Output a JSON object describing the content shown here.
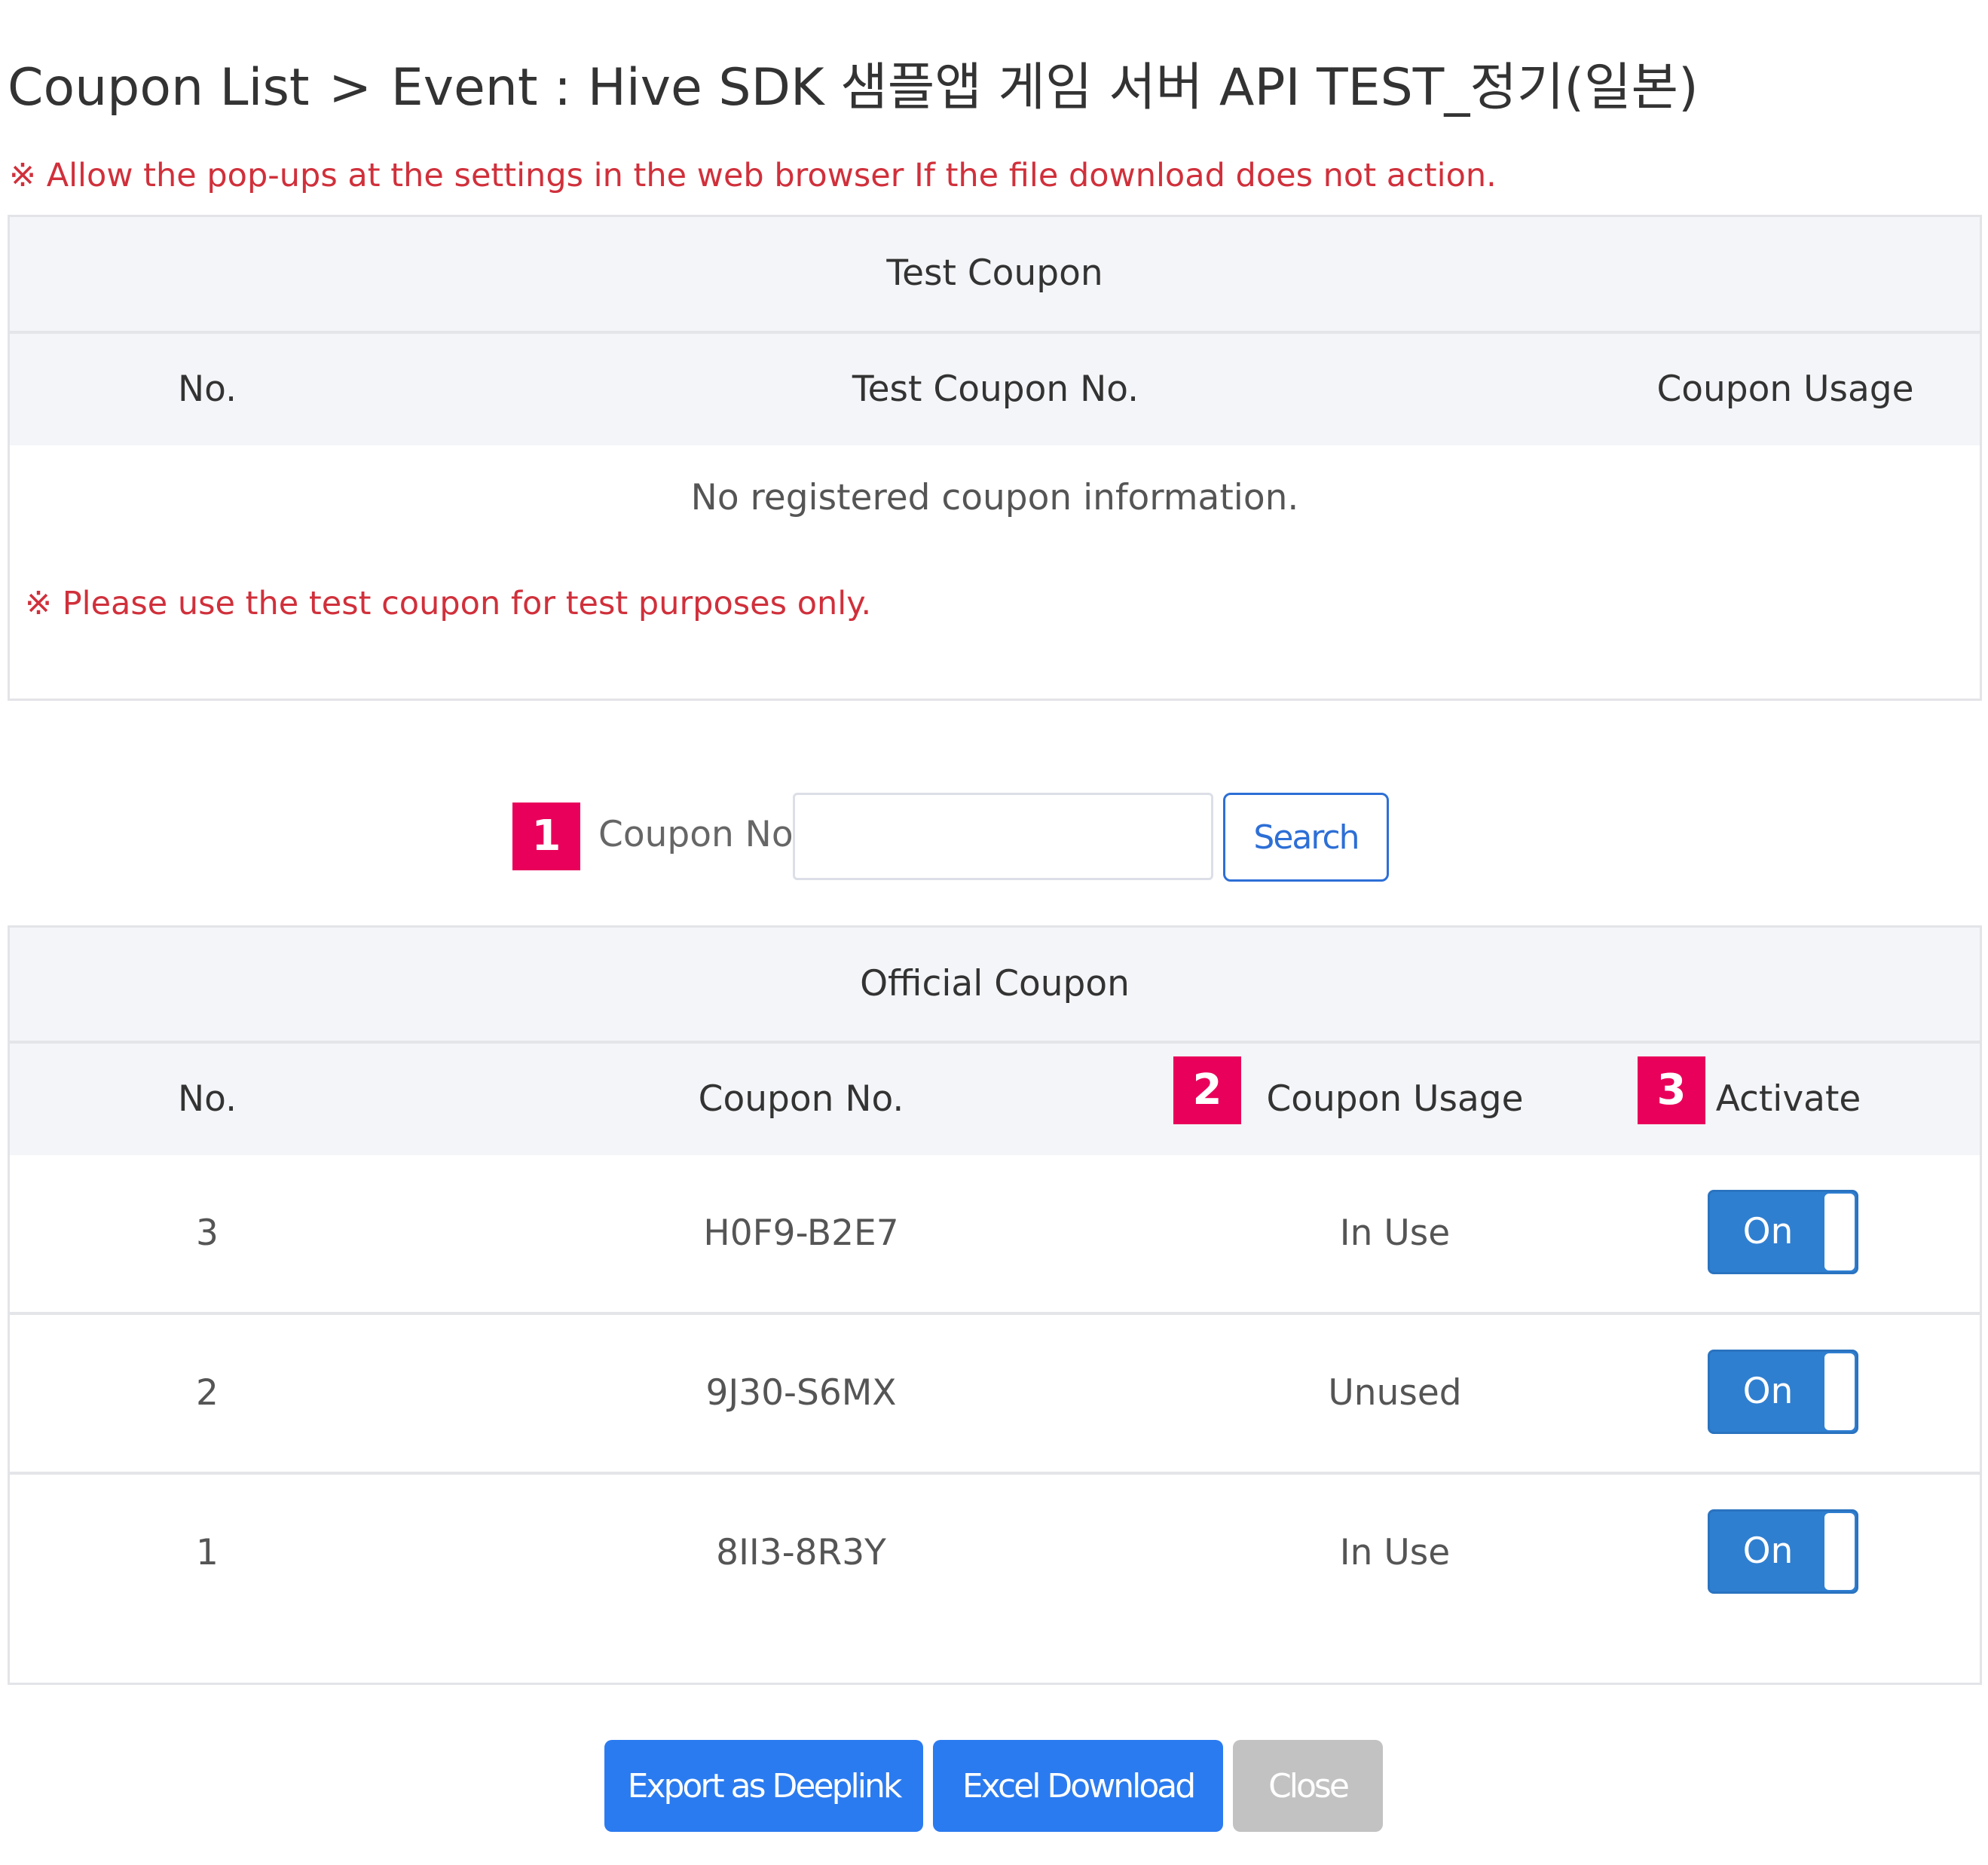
{
  "header": {
    "breadcrumb_root": "Coupon List",
    "breadcrumb_separator": ">",
    "breadcrumb_current": "Event : Hive SDK 샘플앱 게임 서버 API TEST_정기(일본)"
  },
  "popup_notice": "※ Allow the pop-ups at the settings in the web browser If the file download does not action.",
  "test_coupon": {
    "title": "Test Coupon",
    "columns": [
      "No.",
      "Test Coupon No.",
      "Coupon Usage"
    ],
    "empty_message": "No registered coupon information.",
    "hint": "※ Please use the test coupon for test purposes only."
  },
  "search": {
    "marker": "1",
    "label": "Coupon No.",
    "value": "",
    "placeholder": "",
    "button": "Search"
  },
  "official_coupon": {
    "title": "Official Coupon",
    "columns": {
      "no": "No.",
      "coupon_no": "Coupon No.",
      "usage": "Coupon Usage",
      "activate": "Activate"
    },
    "markers": {
      "usage": "2",
      "activate": "3"
    },
    "rows": [
      {
        "no": "3",
        "coupon_no": "H0F9-B2E7",
        "usage": "In Use",
        "activate": "On"
      },
      {
        "no": "2",
        "coupon_no": "9J30-S6MX",
        "usage": "Unused",
        "activate": "On"
      },
      {
        "no": "1",
        "coupon_no": "8II3-8R3Y",
        "usage": "In Use",
        "activate": "On"
      }
    ]
  },
  "footer": {
    "export_deeplink": "Export as Deeplink",
    "excel_download": "Excel Download",
    "close": "Close"
  },
  "colors": {
    "marker": "#e8005a",
    "notice_red": "#d0303b",
    "primary_blue": "#2b7bf0",
    "toggle_blue": "#2f7fd1",
    "disabled_gray": "#c2c2c2"
  }
}
